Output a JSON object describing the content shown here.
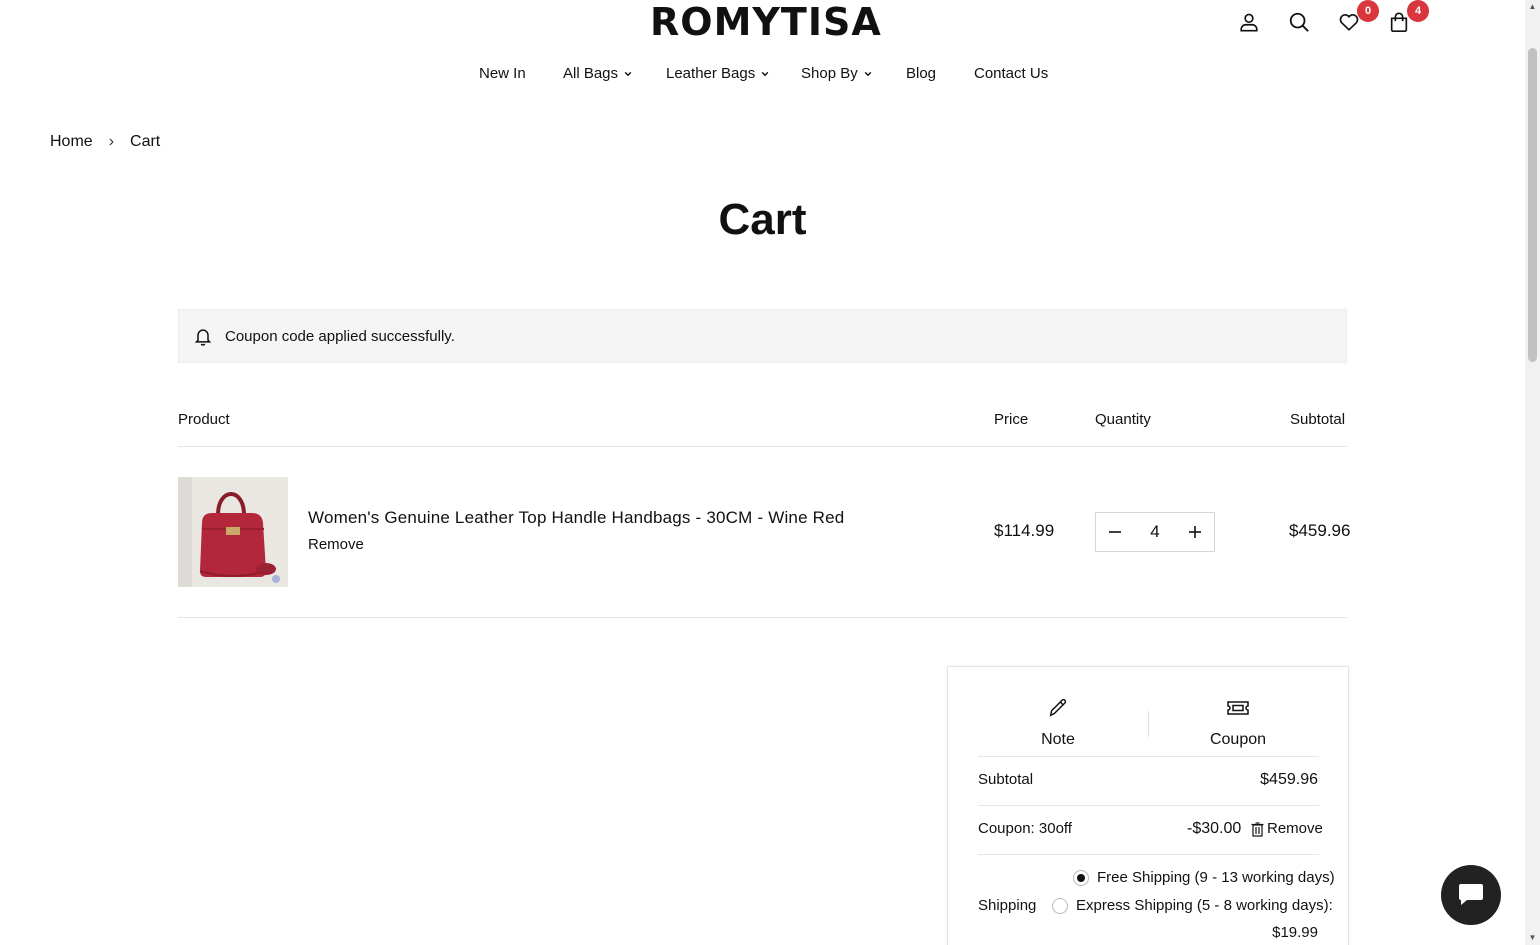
{
  "header": {
    "logo": "ROMYTISA",
    "wishlist_count": "0",
    "cart_count": "4",
    "icons": [
      "account-icon",
      "search-icon",
      "heart-icon",
      "bag-icon"
    ],
    "badge_color": "#d9363e"
  },
  "nav": {
    "items": [
      {
        "label": "New In",
        "dropdown": false
      },
      {
        "label": "All Bags",
        "dropdown": true
      },
      {
        "label": "Leather Bags",
        "dropdown": true
      },
      {
        "label": "Shop By",
        "dropdown": true
      },
      {
        "label": "Blog",
        "dropdown": false
      },
      {
        "label": "Contact Us",
        "dropdown": false
      }
    ]
  },
  "breadcrumb": {
    "home": "Home",
    "separator": "›",
    "current": "Cart"
  },
  "page_title": "Cart",
  "notice": {
    "message": "Coupon code applied successfully."
  },
  "table": {
    "headers": {
      "product": "Product",
      "price": "Price",
      "quantity": "Quantity",
      "subtotal": "Subtotal"
    },
    "items": [
      {
        "name": "Women's Genuine Leather Top Handle Handbags - 30CM - Wine Red",
        "remove": "Remove",
        "price": "$114.99",
        "quantity": "4",
        "subtotal": "$459.96"
      }
    ]
  },
  "summary": {
    "tabs": {
      "note": "Note",
      "coupon": "Coupon"
    },
    "subtotal_label": "Subtotal",
    "subtotal_value": "$459.96",
    "coupon_label": "Coupon: 30off",
    "coupon_value": "-$30.00",
    "coupon_remove": "Remove",
    "shipping_label": "Shipping",
    "shipping_options": [
      {
        "label": "Free Shipping (9 - 13 working days)",
        "selected": true
      },
      {
        "label": "Express Shipping (5 - 8 working days):",
        "price": "$19.99",
        "selected": false
      }
    ]
  },
  "chat": {
    "icon": "chat-icon"
  }
}
